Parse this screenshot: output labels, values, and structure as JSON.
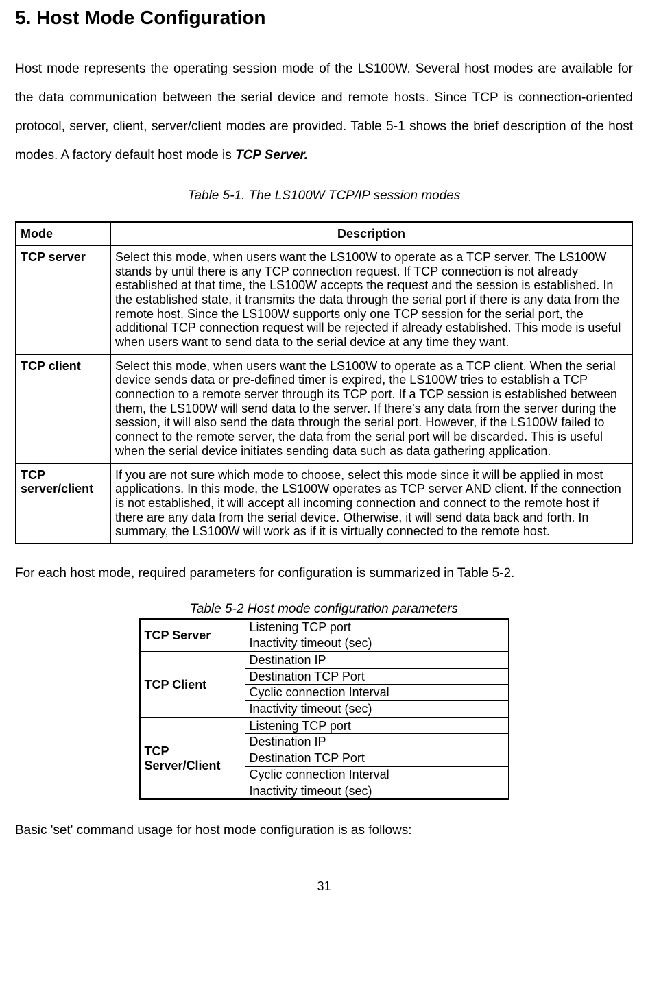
{
  "section_title": "5. Host Mode Configuration",
  "intro": {
    "pre": "Host mode represents the operating session mode of the LS100W. Several host modes are available for the data communication between the serial device and remote hosts. Since TCP is connection-oriented protocol, server, client, server/client modes are provided. Table 5-1 shows the brief description of the host modes. A factory default host mode is ",
    "bold": "TCP Server."
  },
  "table1": {
    "caption": "Table 5-1. The LS100W TCP/IP session modes",
    "headers": {
      "mode": "Mode",
      "desc": "Description"
    },
    "rows": [
      {
        "mode": "TCP server",
        "desc": "Select this mode, when users want the LS100W to operate as a TCP server. The LS100W stands by until there is any TCP connection request. If TCP connection is not already established at that time, the LS100W accepts the request and the session is established. In the established state, it transmits the data through the serial port if there is any data from the remote host. Since the LS100W supports only one TCP session for the serial port, the additional TCP connection request will be rejected if already established. This mode is useful when users want to send data to the serial device at any time they want."
      },
      {
        "mode": "TCP client",
        "desc": "Select this mode, when users want the LS100W to operate as a TCP client. When the serial device sends data or pre-defined timer is expired, the LS100W tries to establish a TCP connection to a remote server through its TCP port. If a TCP session is established between them, the LS100W will send data to the server. If there's any data from the server during the session, it will also send the data through the serial port. However, if the LS100W failed to connect to the remote server, the data from the serial port will be discarded. This is useful when the serial device initiates sending data such as data gathering application."
      },
      {
        "mode": "TCP server/client",
        "desc": "If you are not sure which mode to choose, select this mode since it will be applied in most applications. In this mode, the LS100W operates as TCP server AND client. If the connection is not established, it will accept all incoming connection and connect to the remote host if there are any data from the serial device. Otherwise, it will send data back and forth. In summary, the LS100W will work as if it is virtually connected to the remote host."
      }
    ]
  },
  "mid_text": "For each host mode, required parameters for configuration is summarized in Table 5-2.",
  "table2": {
    "caption": "Table 5-2 Host mode configuration parameters",
    "groups": [
      {
        "label": "TCP Server",
        "params": [
          "Listening TCP port",
          "Inactivity timeout (sec)"
        ]
      },
      {
        "label": "TCP Client",
        "params": [
          "Destination IP",
          "Destination TCP Port",
          "Cyclic connection Interval",
          "Inactivity timeout (sec)"
        ]
      },
      {
        "label": "TCP Server/Client",
        "params": [
          "Listening TCP port",
          "Destination IP",
          "Destination TCP Port",
          "Cyclic connection Interval",
          "Inactivity timeout (sec)"
        ]
      }
    ]
  },
  "closing_text": "Basic 'set' command usage for host mode configuration is as follows:",
  "page_number": "31"
}
